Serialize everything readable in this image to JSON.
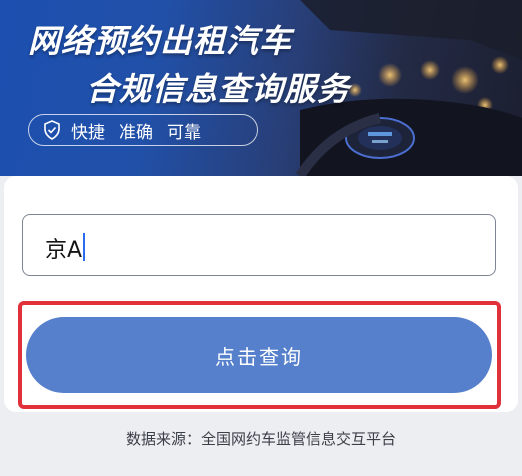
{
  "banner": {
    "title_line1": "网络预约出租汽车",
    "title_line2": "合规信息查询服务",
    "features": [
      "快捷",
      "准确",
      "可靠"
    ]
  },
  "search": {
    "plate_value": "京A"
  },
  "query_button": {
    "label": "点击查询"
  },
  "footer": {
    "source_text": "数据来源：全国网约车监管信息交互平台"
  },
  "colors": {
    "banner_blue": "#1c4fb0",
    "button_blue": "#5680cb",
    "highlight_red": "#e0303a"
  }
}
